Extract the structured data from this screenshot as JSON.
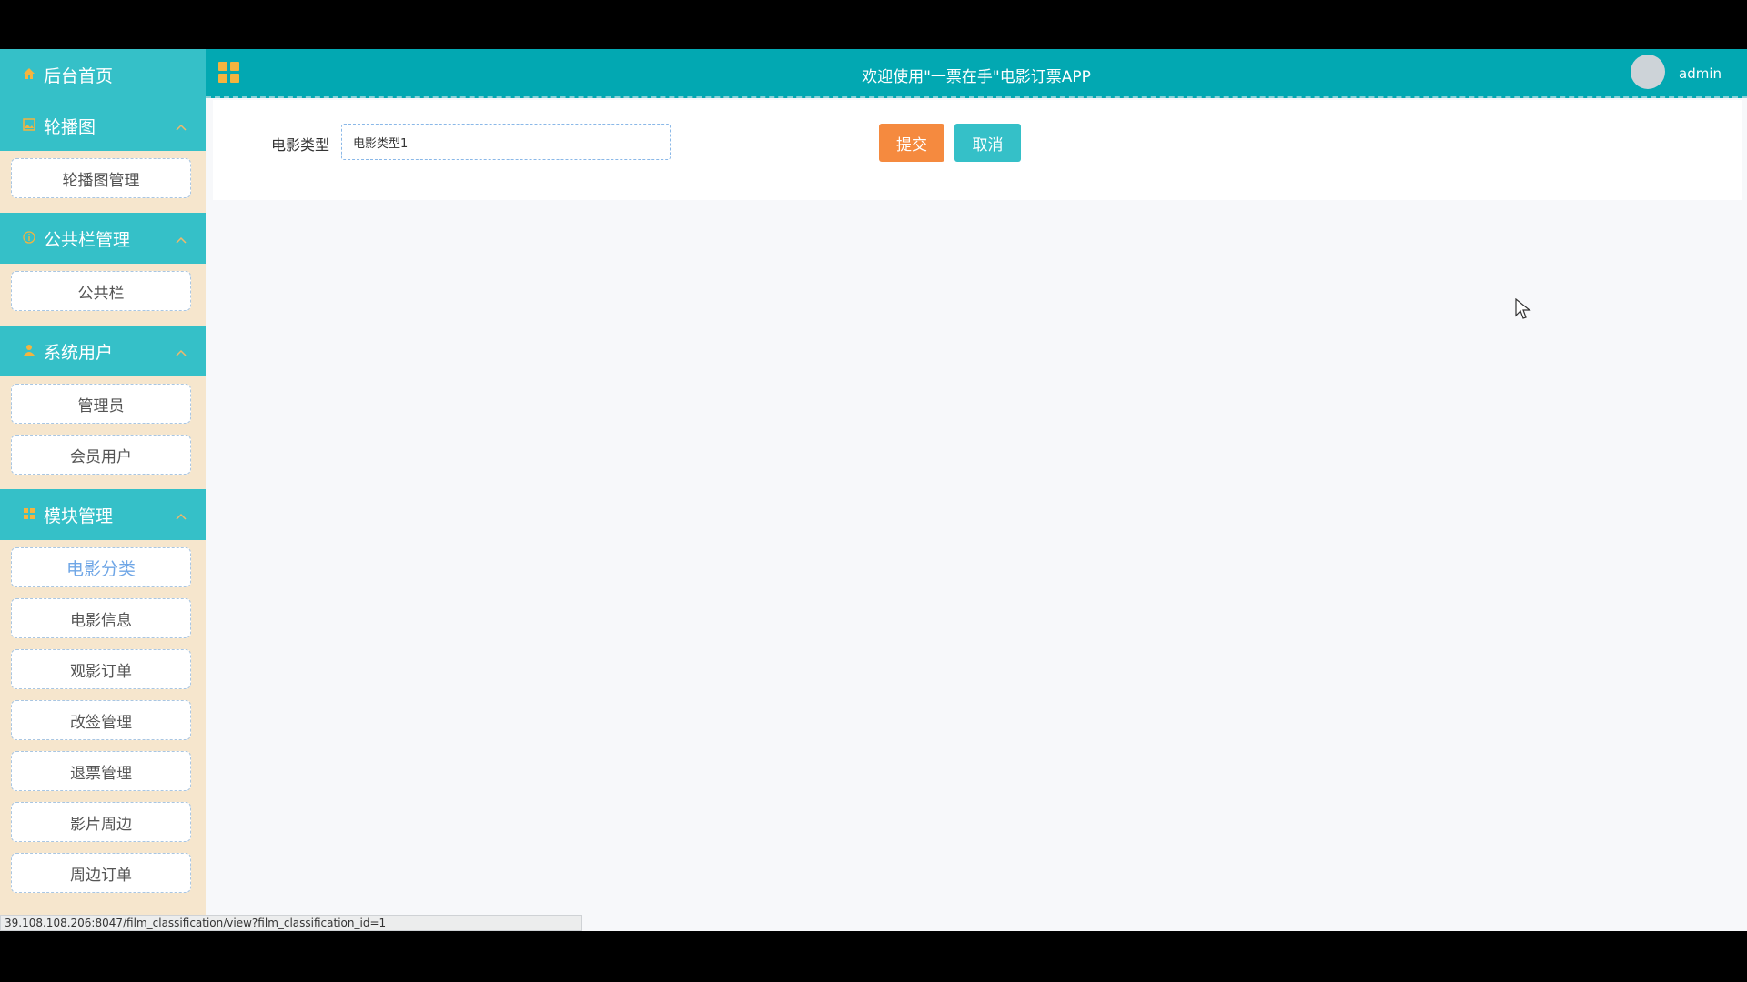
{
  "header": {
    "title": "欢迎使用\"一票在手\"电影订票APP",
    "user": "admin"
  },
  "sidebar": {
    "home_label": "后台首页",
    "sections": [
      {
        "label": "轮播图",
        "icon": "image-icon",
        "items": [
          "轮播图管理"
        ]
      },
      {
        "label": "公共栏管理",
        "icon": "info-circle-icon",
        "items": [
          "公共栏"
        ]
      },
      {
        "label": "系统用户",
        "icon": "user-icon",
        "items": [
          "管理员",
          "会员用户"
        ]
      },
      {
        "label": "模块管理",
        "icon": "grid-icon",
        "items": [
          "电影分类",
          "电影信息",
          "观影订单",
          "改签管理",
          "退票管理",
          "影片周边",
          "周边订单"
        ]
      }
    ],
    "active_item": "电影分类"
  },
  "form": {
    "field_label": "电影类型",
    "field_value": "电影类型1",
    "submit_label": "提交",
    "cancel_label": "取消"
  },
  "status_url": "39.108.108.206:8047/film_classification/view?film_classification_id=1",
  "colors": {
    "header": "#02a8b2",
    "sidebar_head": "#35c0c8",
    "sidebar_bg": "#f6e6cd",
    "submit": "#f58a3f",
    "cancel": "#35c0c8"
  }
}
